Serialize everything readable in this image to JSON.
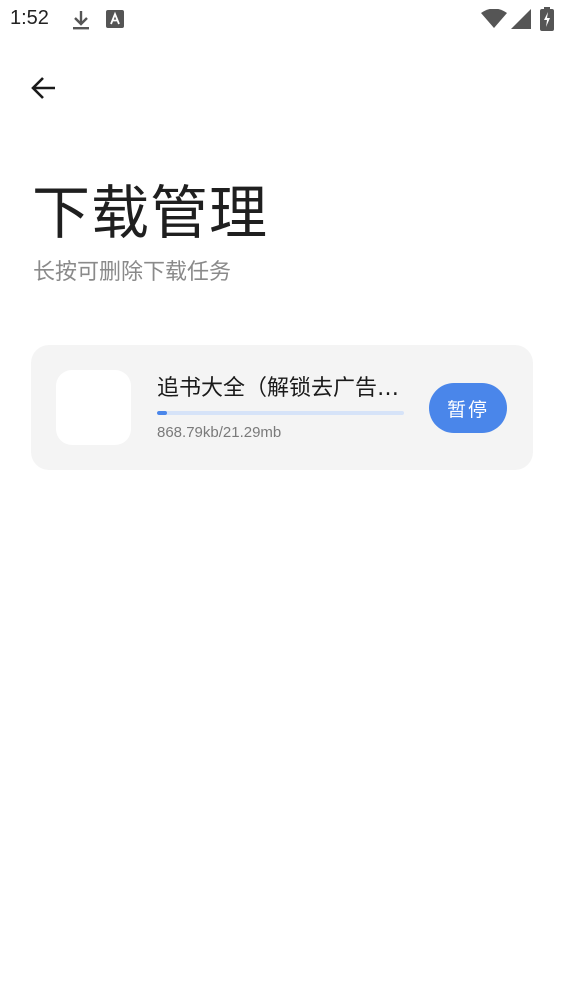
{
  "status_bar": {
    "time": "1:52",
    "icons": [
      "download-icon",
      "text-a-icon",
      "wifi-icon",
      "signal-icon",
      "battery-charging-icon"
    ]
  },
  "header": {
    "back_icon": "arrow-left-icon",
    "title": "下载管理",
    "subtitle": "长按可删除下载任务"
  },
  "downloads": [
    {
      "name": "追书大全（解锁去广告版）",
      "size_text": "868.79kb/21.29mb",
      "progress": 0.04,
      "action_label": "暂停"
    }
  ],
  "colors": {
    "accent": "#4a86ea",
    "card_bg": "#f4f4f4",
    "progress_track": "#d6e3f8"
  }
}
